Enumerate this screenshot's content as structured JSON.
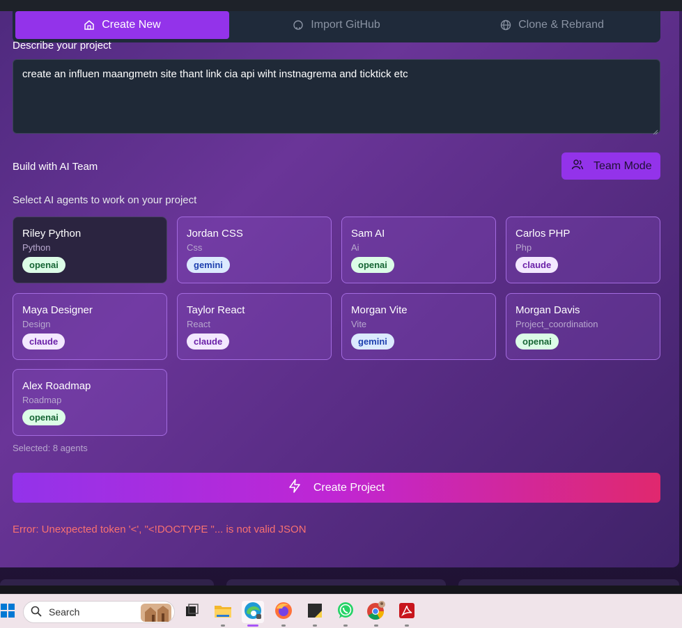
{
  "tabs": [
    {
      "label": "Create New",
      "icon": "home-icon"
    },
    {
      "label": "Import GitHub",
      "icon": "github-icon"
    },
    {
      "label": "Clone & Rebrand",
      "icon": "globe-icon"
    }
  ],
  "describe": {
    "label": "Describe your project",
    "value": "create an influen maangmetn site thant link cia api wiht instnagrema and ticktick etc"
  },
  "team": {
    "label": "Build with AI Team",
    "button_label": "Team Mode"
  },
  "agents_label": "Select AI agents to work on your project",
  "agents": [
    {
      "name": "Riley Python",
      "role": "Python",
      "provider": "openai",
      "selected": true
    },
    {
      "name": "Jordan CSS",
      "role": "Css",
      "provider": "gemini",
      "selected": false
    },
    {
      "name": "Sam AI",
      "role": "Ai",
      "provider": "openai",
      "selected": false
    },
    {
      "name": "Carlos PHP",
      "role": "Php",
      "provider": "claude",
      "selected": false
    },
    {
      "name": "Maya Designer",
      "role": "Design",
      "provider": "claude",
      "selected": false
    },
    {
      "name": "Taylor React",
      "role": "React",
      "provider": "claude",
      "selected": false
    },
    {
      "name": "Morgan Vite",
      "role": "Vite",
      "provider": "gemini",
      "selected": false
    },
    {
      "name": "Morgan Davis",
      "role": "Project_coordination",
      "provider": "openai",
      "selected": false
    },
    {
      "name": "Alex Roadmap",
      "role": "Roadmap",
      "provider": "openai",
      "selected": false
    }
  ],
  "selected_count": "Selected: 8 agents",
  "create_button": "Create Project",
  "error": "Error: Unexpected token '<', \"<!DOCTYPE \"... is not valid JSON",
  "taskbar": {
    "search_placeholder": "Search",
    "apps": [
      "task-view",
      "file-explorer",
      "edge",
      "firefox",
      "sticky-notes",
      "whatsapp",
      "chrome",
      "acrobat"
    ]
  },
  "colors": {
    "accent": "#9333ea",
    "error": "#f87171",
    "gradient_end": "#e0286e"
  }
}
